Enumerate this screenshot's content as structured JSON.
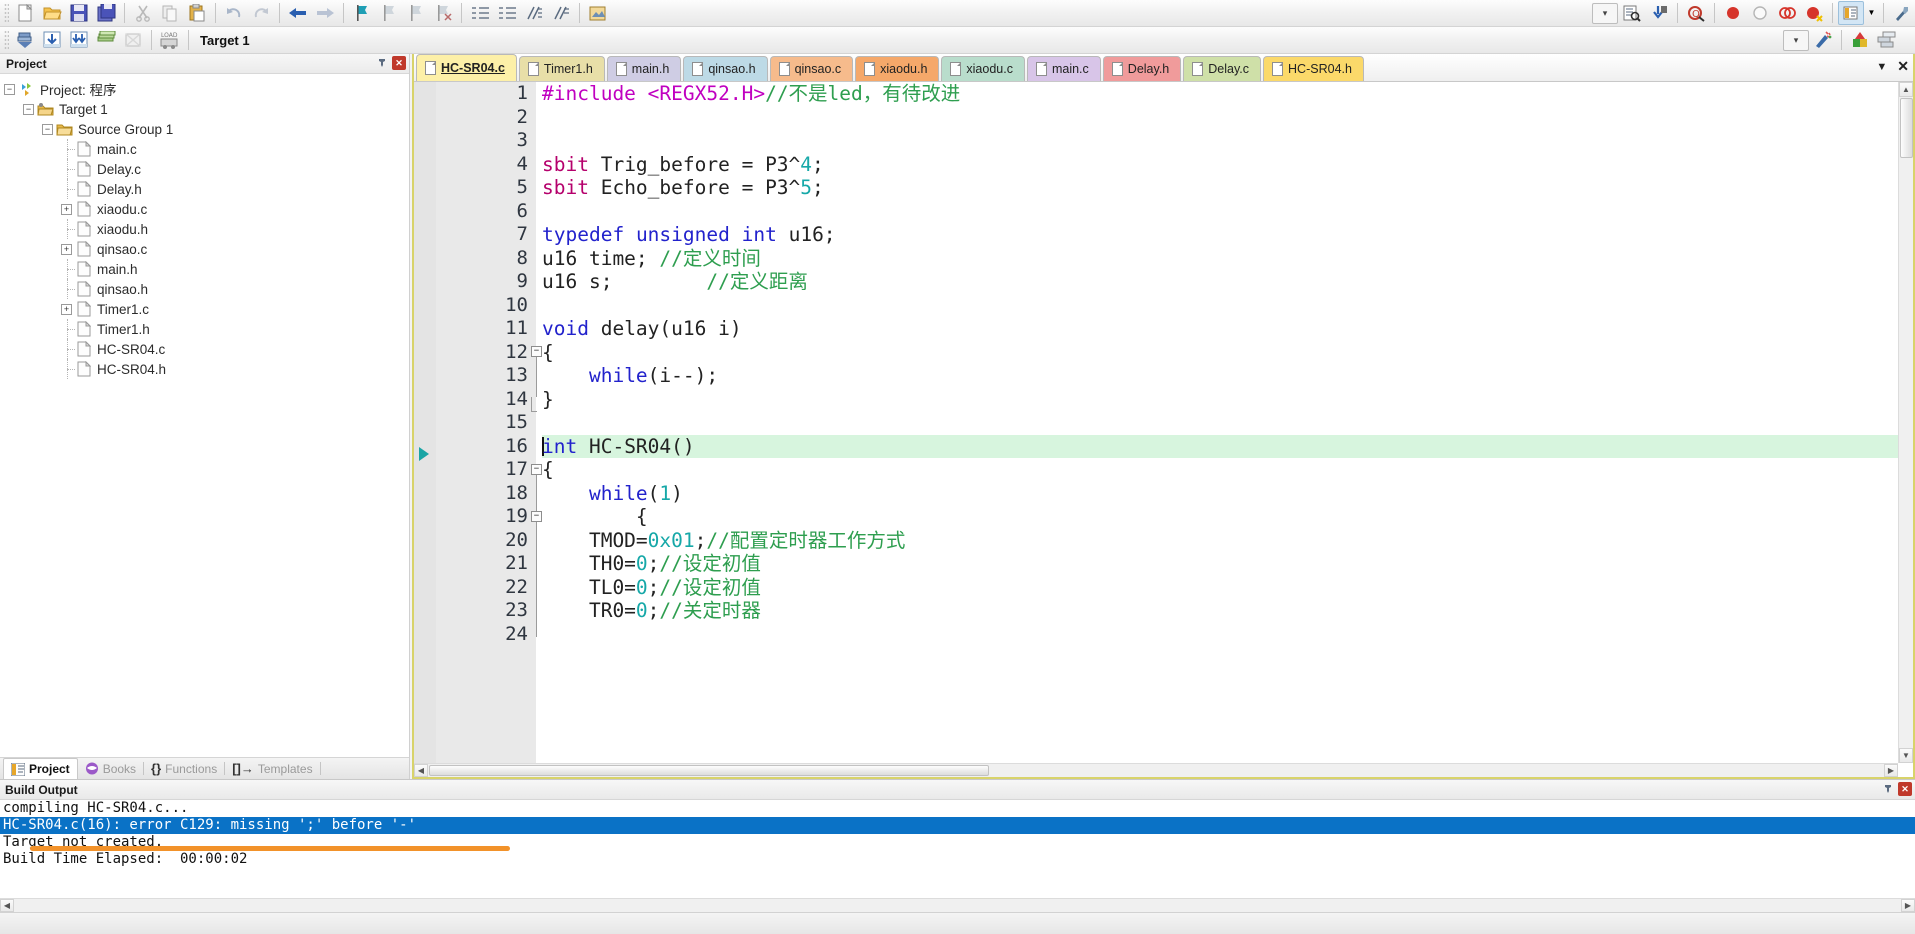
{
  "toolbar_top": {
    "icons": [
      {
        "name": "new-file-icon",
        "glyph": "⬜"
      },
      {
        "name": "open-file-icon",
        "glyph": "📂"
      },
      {
        "name": "save-icon",
        "glyph": "💾"
      },
      {
        "name": "save-all-icon",
        "glyph": "🖫"
      },
      {
        "name": "cut-icon",
        "glyph": "✂"
      },
      {
        "name": "copy-icon",
        "glyph": "⧉"
      },
      {
        "name": "paste-icon",
        "glyph": "📋"
      },
      {
        "name": "undo-icon",
        "glyph": "↶"
      },
      {
        "name": "redo-icon",
        "glyph": "↷"
      },
      {
        "name": "navigate-back-icon",
        "glyph": "←"
      },
      {
        "name": "navigate-forward-icon",
        "glyph": "→"
      },
      {
        "name": "bookmark-toggle-icon",
        "glyph": "⚑"
      },
      {
        "name": "bookmark-prev-icon",
        "glyph": "⚑"
      },
      {
        "name": "bookmark-next-icon",
        "glyph": "⚑"
      },
      {
        "name": "bookmark-clear-icon",
        "glyph": "⚑"
      },
      {
        "name": "indent-increase-icon",
        "glyph": "⇥"
      },
      {
        "name": "indent-decrease-icon",
        "glyph": "⇤"
      },
      {
        "name": "comment-lines-icon",
        "glyph": "⫽"
      },
      {
        "name": "uncomment-lines-icon",
        "glyph": "⫽"
      },
      {
        "name": "insert-file-icon",
        "glyph": "🖼"
      }
    ],
    "right_icons": [
      {
        "name": "find-combo-dropdown-icon",
        "glyph": "▾"
      },
      {
        "name": "find-in-files-icon",
        "glyph": "🔍"
      },
      {
        "name": "goto-definition-icon",
        "glyph": "⬇"
      },
      {
        "name": "find-next-icon",
        "glyph": "🔎"
      },
      {
        "name": "breakpoint-insert-icon",
        "glyph": "●"
      },
      {
        "name": "breakpoint-disable-icon",
        "glyph": "○"
      },
      {
        "name": "breakpoint-kill-all-icon",
        "glyph": "◍"
      },
      {
        "name": "breakpoint-disable-all-icon",
        "glyph": "◉"
      },
      {
        "name": "project-window-icon",
        "glyph": "🗔"
      },
      {
        "name": "project-window-dropdown-icon",
        "glyph": "▾"
      },
      {
        "name": "configure-icon",
        "glyph": "🔧"
      }
    ]
  },
  "toolbar_build": {
    "icons": [
      {
        "name": "translate-icon",
        "glyph": "⬇"
      },
      {
        "name": "build-target-icon",
        "glyph": "⊞"
      },
      {
        "name": "rebuild-all-icon",
        "glyph": "⊞"
      },
      {
        "name": "batch-build-icon",
        "glyph": "▤"
      },
      {
        "name": "stop-build-icon",
        "glyph": "☒"
      },
      {
        "name": "download-icon",
        "glyph": "⬇"
      }
    ],
    "target_label": "Target 1",
    "right_icons": [
      {
        "name": "select-target-dropdown-icon",
        "glyph": "▾"
      },
      {
        "name": "options-for-target-icon",
        "glyph": "✨"
      },
      {
        "name": "manage-project-items-icon",
        "glyph": "■"
      },
      {
        "name": "manage-multi-project-icon",
        "glyph": "▧"
      }
    ]
  },
  "project_pane": {
    "title": "Project",
    "pin_icon": "📌",
    "close_icon": "✕",
    "tree": [
      {
        "label": "Project: 程序",
        "depth": 0,
        "expander": "-",
        "icon": "project-icon"
      },
      {
        "label": "Target 1",
        "depth": 1,
        "expander": "-",
        "icon": "target-icon"
      },
      {
        "label": "Source Group 1",
        "depth": 2,
        "expander": "-",
        "icon": "folder-icon"
      },
      {
        "label": "main.c",
        "depth": 3,
        "expander": "",
        "icon": "file-icon"
      },
      {
        "label": "Delay.c",
        "depth": 3,
        "expander": "",
        "icon": "file-icon"
      },
      {
        "label": "Delay.h",
        "depth": 3,
        "expander": "",
        "icon": "file-icon"
      },
      {
        "label": "xiaodu.c",
        "depth": 3,
        "expander": "+",
        "icon": "file-icon"
      },
      {
        "label": "xiaodu.h",
        "depth": 3,
        "expander": "",
        "icon": "file-icon"
      },
      {
        "label": "qinsao.c",
        "depth": 3,
        "expander": "+",
        "icon": "file-icon"
      },
      {
        "label": "main.h",
        "depth": 3,
        "expander": "",
        "icon": "file-icon"
      },
      {
        "label": "qinsao.h",
        "depth": 3,
        "expander": "",
        "icon": "file-icon"
      },
      {
        "label": "Timer1.c",
        "depth": 3,
        "expander": "+",
        "icon": "file-icon"
      },
      {
        "label": "Timer1.h",
        "depth": 3,
        "expander": "",
        "icon": "file-icon"
      },
      {
        "label": "HC-SR04.c",
        "depth": 3,
        "expander": "",
        "icon": "file-icon"
      },
      {
        "label": "HC-SR04.h",
        "depth": 3,
        "expander": "",
        "icon": "file-icon"
      }
    ],
    "bottom_tabs": [
      {
        "label": "Project",
        "icon": "project-tab-icon",
        "active": true
      },
      {
        "label": "Books",
        "icon": "books-tab-icon",
        "active": false
      },
      {
        "label": "Functions",
        "icon": "functions-tab-icon",
        "active": false
      },
      {
        "label": "Templates",
        "icon": "templates-tab-icon",
        "active": false
      }
    ]
  },
  "editor": {
    "tabs": [
      {
        "label": "HC-SR04.c",
        "color": "#fdf0a8",
        "active": true
      },
      {
        "label": "Timer1.h",
        "color": "#e8dfa8",
        "active": false
      },
      {
        "label": "main.h",
        "color": "#cfcde4",
        "active": false
      },
      {
        "label": "qinsao.h",
        "color": "#bddae6",
        "active": false
      },
      {
        "label": "qinsao.c",
        "color": "#f6bb8c",
        "active": false
      },
      {
        "label": "xiaodu.h",
        "color": "#f5a86a",
        "active": false
      },
      {
        "label": "xiaodu.c",
        "color": "#b9ddcc",
        "active": false
      },
      {
        "label": "main.c",
        "color": "#d8c5e8",
        "active": false
      },
      {
        "label": "Delay.h",
        "color": "#f09b9b",
        "active": false
      },
      {
        "label": "Delay.c",
        "color": "#cfe0a8",
        "active": false
      },
      {
        "label": "HC-SR04.h",
        "color": "#fbd96a",
        "active": false
      }
    ],
    "tabbar_right": {
      "dropdown_icon": "▾",
      "close_icon": "✕"
    },
    "lines": [
      {
        "n": 1,
        "text": "#include <REGX52.H>//不是led，有待改进"
      },
      {
        "n": 2,
        "text": ""
      },
      {
        "n": 3,
        "text": ""
      },
      {
        "n": 4,
        "text": "sbit Trig_before = P3^4;"
      },
      {
        "n": 5,
        "text": "sbit Echo_before = P3^5;"
      },
      {
        "n": 6,
        "text": ""
      },
      {
        "n": 7,
        "text": "typedef unsigned int u16;"
      },
      {
        "n": 8,
        "text": "u16 time; //定义时间"
      },
      {
        "n": 9,
        "text": "u16 s;        //定义距离"
      },
      {
        "n": 10,
        "text": ""
      },
      {
        "n": 11,
        "text": "void delay(u16 i)"
      },
      {
        "n": 12,
        "text": "{"
      },
      {
        "n": 13,
        "text": "    while(i--);"
      },
      {
        "n": 14,
        "text": "}"
      },
      {
        "n": 15,
        "text": ""
      },
      {
        "n": 16,
        "text": "int HC-SR04()"
      },
      {
        "n": 17,
        "text": "{"
      },
      {
        "n": 18,
        "text": "    while(1)"
      },
      {
        "n": 19,
        "text": "        {"
      },
      {
        "n": 20,
        "text": "    TMOD=0x01;//配置定时器工作方式"
      },
      {
        "n": 21,
        "text": "    TH0=0;//设定初值"
      },
      {
        "n": 22,
        "text": "    TL0=0;//设定初值"
      },
      {
        "n": 23,
        "text": "    TR0=0;//关定时器"
      },
      {
        "n": 24,
        "text": ""
      }
    ],
    "highlighted_line": 16,
    "breakpoint_marker_line": 16
  },
  "build_output": {
    "title": "Build Output",
    "pin_icon": "📌",
    "close_icon": "✕",
    "lines": [
      {
        "text": "compiling HC-SR04.c...",
        "selected": false
      },
      {
        "text": "HC-SR04.c(16): error C129: missing ';' before '-'",
        "selected": true
      },
      {
        "text": "Target not created.",
        "selected": false
      },
      {
        "text": "Build Time Elapsed:  00:00:02",
        "selected": false
      }
    ],
    "annotation_color": "#f2922a"
  },
  "statusbar": {
    "text": ""
  },
  "colors": {
    "selection_blue": "#0a72c6",
    "highlight_green": "#d7f5de",
    "editor_border": "#d8d36a",
    "annotation_orange": "#f2922a"
  }
}
